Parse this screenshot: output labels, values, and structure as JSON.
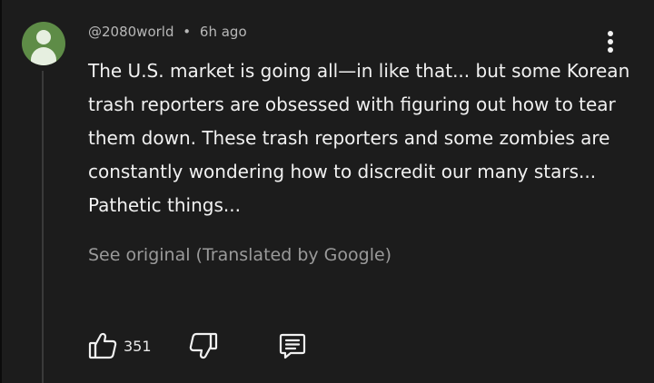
{
  "comment": {
    "author": "@2080world",
    "separator": "•",
    "time": "6h ago",
    "text": "The U.S. market is going all—in like that... but some Korean trash reporters are obsessed with figuring out how to tear them down. These trash reporters and some zombies are constantly wondering how to discredit our many stars... Pathetic things...",
    "see_original": "See original (Translated by Google)"
  },
  "actions": {
    "like_count": "351"
  },
  "icons": {
    "avatar": "default-avatar-icon",
    "more": "more-vertical-icon",
    "like": "thumbs-up-icon",
    "dislike": "thumbs-down-icon",
    "reply": "reply-comment-icon"
  },
  "colors": {
    "background": "#1c1c1c",
    "text": "#f1f1f1",
    "muted": "#9a9a9a",
    "avatar": "#5e8c47"
  }
}
